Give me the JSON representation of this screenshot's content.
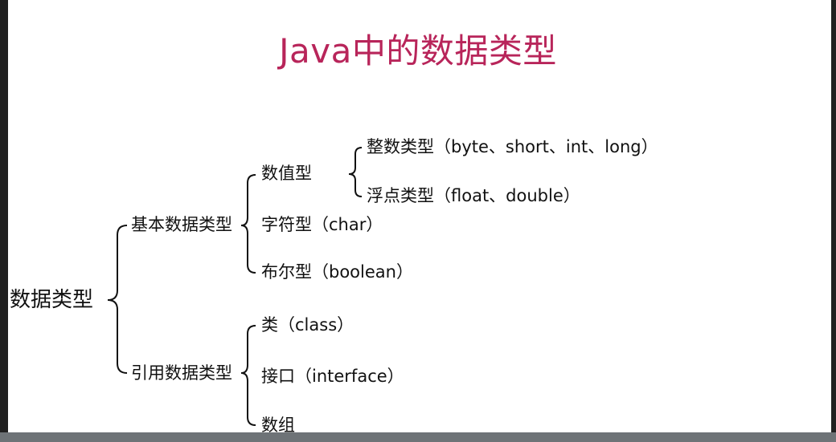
{
  "title": "Java中的数据类型",
  "tree": {
    "root": "数据类型",
    "primitive": {
      "label": "基本数据类型",
      "numeric": {
        "label": "数值型",
        "integer": "整数类型（byte、short、int、long）",
        "float": "浮点类型（float、double）"
      },
      "char": "字符型（char）",
      "boolean": "布尔型（boolean）"
    },
    "reference": {
      "label": "引用数据类型",
      "class": "类（class）",
      "interface": "接口（interface）",
      "array": "数组"
    }
  },
  "colors": {
    "title": "#b8255a",
    "text": "#111111",
    "bottom_bar": "#6e7377"
  }
}
